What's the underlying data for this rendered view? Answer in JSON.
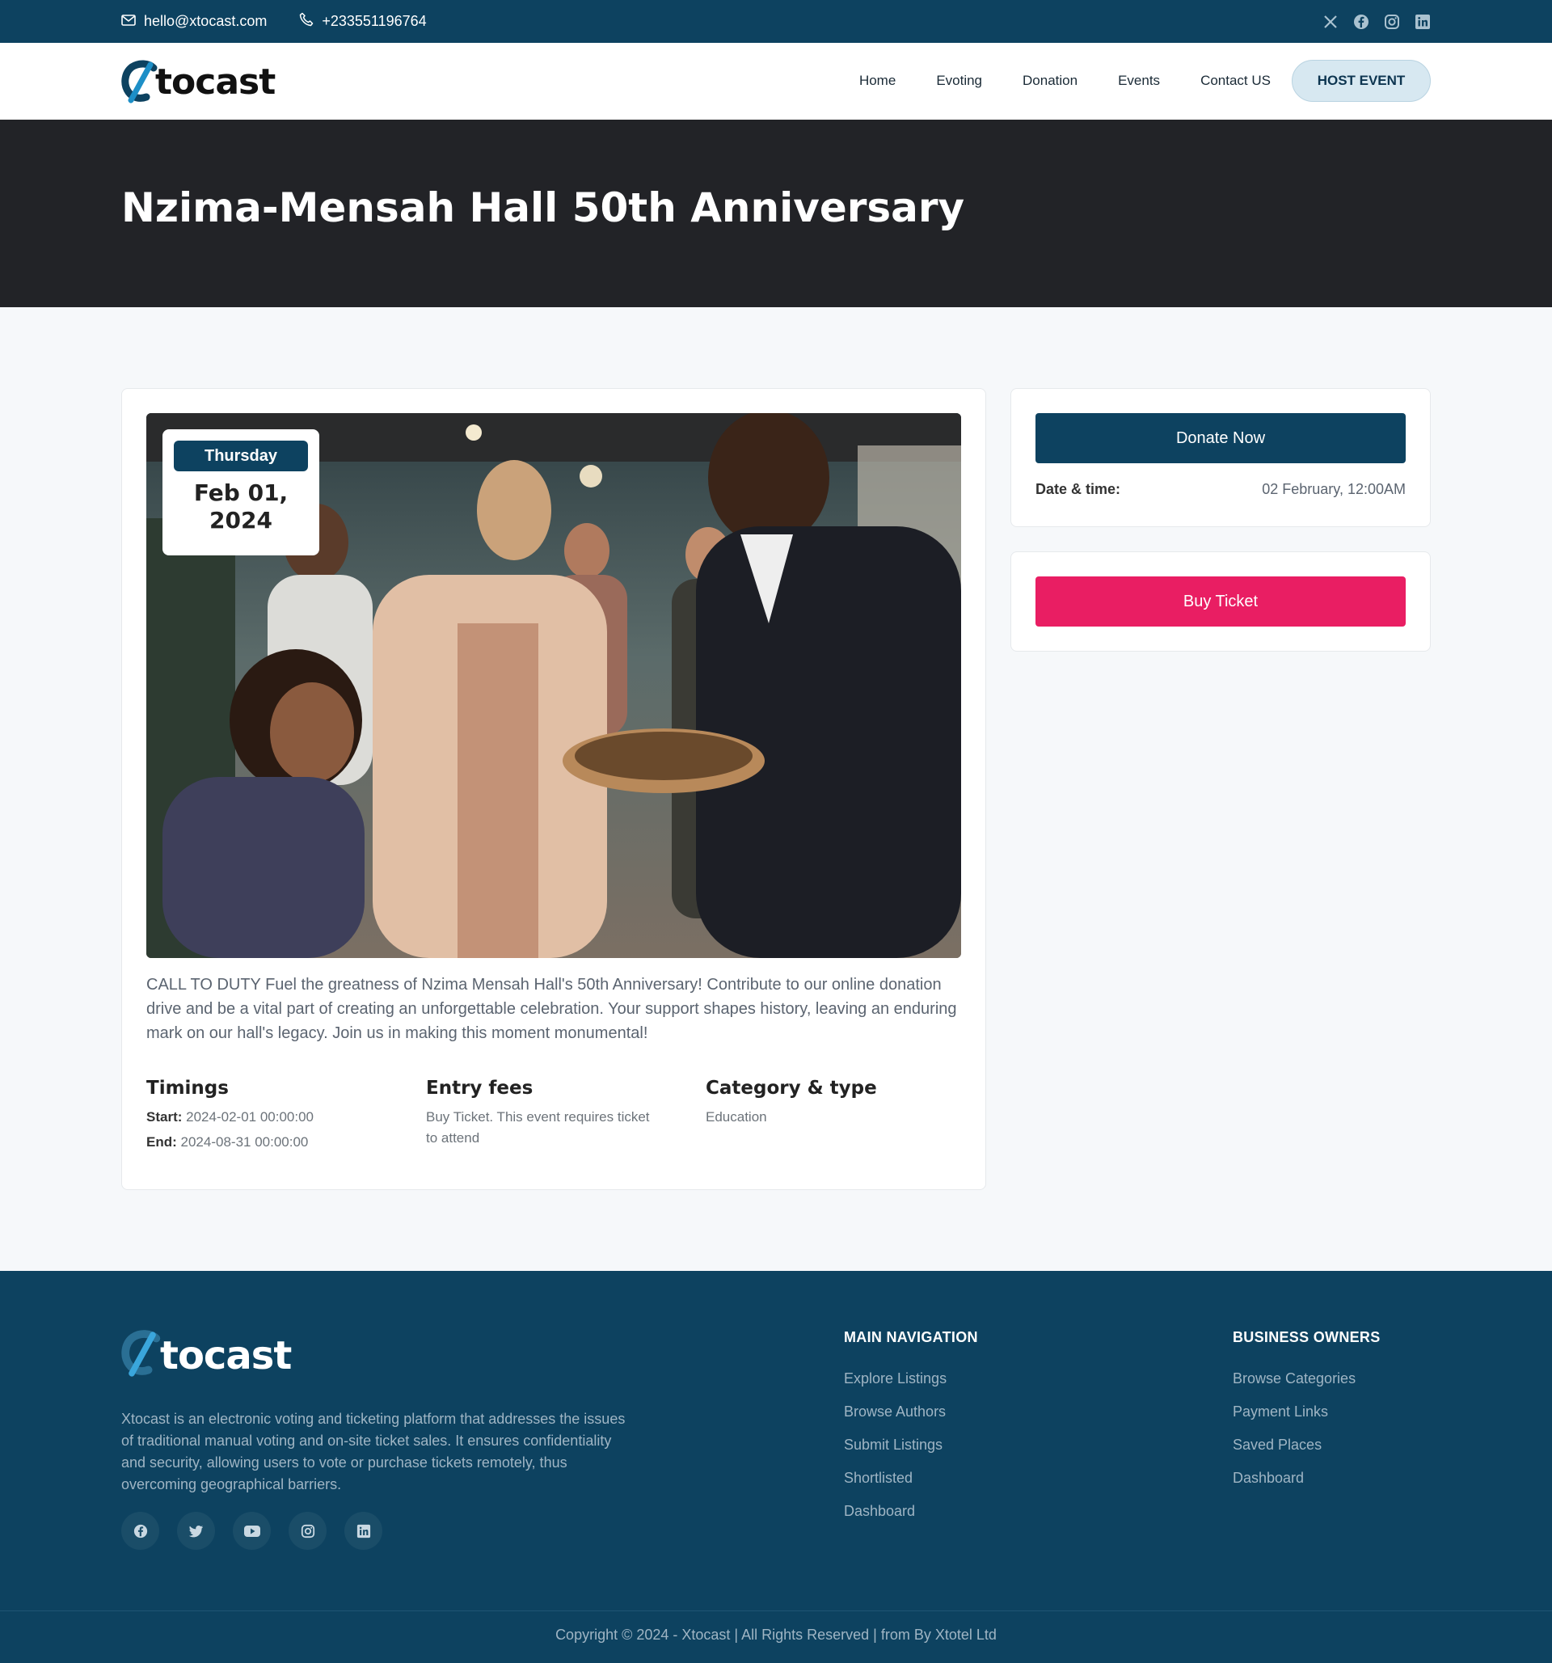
{
  "topbar": {
    "email": "hello@xtocast.com",
    "phone": "+233551196764",
    "social": [
      "x-icon",
      "facebook-icon",
      "instagram-icon",
      "linkedin-icon"
    ]
  },
  "header": {
    "logo_text": "tocast",
    "nav": [
      "Home",
      "Evoting",
      "Donation",
      "Events",
      "Contact US"
    ],
    "cta": "HOST EVENT"
  },
  "hero": {
    "title": "Nzima-Mensah Hall 50th Anniversary"
  },
  "event": {
    "day": "Thursday",
    "date": "Feb 01, 2024",
    "description": "CALL TO DUTY Fuel the greatness of Nzima Mensah Hall's 50th Anniversary! Contribute to our online donation drive and be a vital part of creating an unforgettable celebration. Your support shapes history, leaving an enduring mark on our hall's legacy. Join us in making this moment monumental!",
    "timings": {
      "heading": "Timings",
      "start_label": "Start:",
      "start": "2024-02-01 00:00:00",
      "end_label": "End:",
      "end": "2024-08-31 00:00:00"
    },
    "fees": {
      "heading": "Entry fees",
      "text": "Buy Ticket. This event requires ticket to attend"
    },
    "category": {
      "heading": "Category & type",
      "text": "Education"
    }
  },
  "sidebar": {
    "donate_label": "Donate Now",
    "datetime_label": "Date & time:",
    "datetime_value": "02 February, 12:00AM",
    "ticket_label": "Buy Ticket"
  },
  "footer": {
    "logo_text": "tocast",
    "about": "Xtocast is an electronic voting and ticketing platform that addresses the issues of traditional manual voting and on-site ticket sales. It ensures confidentiality and security, allowing users to vote or purchase tickets remotely, thus overcoming geographical barriers.",
    "main_nav": {
      "heading": "MAIN NAVIGATION",
      "links": [
        "Explore Listings",
        "Browse Authors",
        "Submit Listings",
        "Shortlisted",
        "Dashboard"
      ]
    },
    "business": {
      "heading": "BUSINESS OWNERS",
      "links": [
        "Browse Categories",
        "Payment Links",
        "Saved Places",
        "Dashboard"
      ]
    },
    "social": [
      "facebook-icon",
      "twitter-icon",
      "youtube-icon",
      "instagram-icon",
      "linkedin-icon"
    ],
    "copyright": "Copyright © 2024 - Xtocast | All Rights Reserved | from By Xtotel Ltd"
  },
  "colors": {
    "primary": "#0d4260",
    "accent": "#e91e63",
    "hero_bg": "#222327"
  }
}
